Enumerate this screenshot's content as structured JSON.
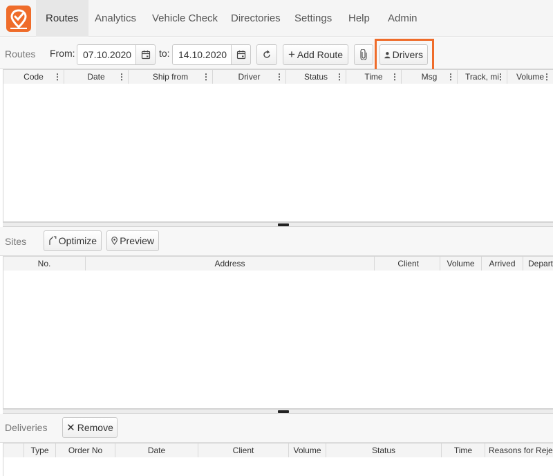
{
  "app": {
    "nav": [
      {
        "label": "Routes",
        "active": true
      },
      {
        "label": "Analytics"
      },
      {
        "label": "Vehicle Check"
      },
      {
        "label": "Directories"
      },
      {
        "label": "Settings"
      },
      {
        "label": "Help"
      },
      {
        "label": "Admin"
      }
    ],
    "accent": "#ef6c2a"
  },
  "routes": {
    "section_label": "Routes",
    "from_label": "From:",
    "from_value": "07.10.2020",
    "to_label": "to:",
    "to_value": "14.10.2020",
    "add_route_label": "Add Route",
    "drivers_label": "Drivers",
    "columns": [
      "Code",
      "Date",
      "Ship from",
      "Driver",
      "Status",
      "Time",
      "Msg",
      "Track, mi",
      "Volume"
    ]
  },
  "sites": {
    "section_label": "Sites",
    "optimize_label": "Optimize",
    "preview_label": "Preview",
    "columns": [
      "No.",
      "Address",
      "Client",
      "Volume",
      "Arrived",
      "Depart"
    ]
  },
  "deliveries": {
    "section_label": "Deliveries",
    "remove_label": "Remove",
    "columns": [
      "Type",
      "Order No",
      "Date",
      "Client",
      "Volume",
      "Status",
      "Time",
      "Reasons for Rejec"
    ]
  }
}
